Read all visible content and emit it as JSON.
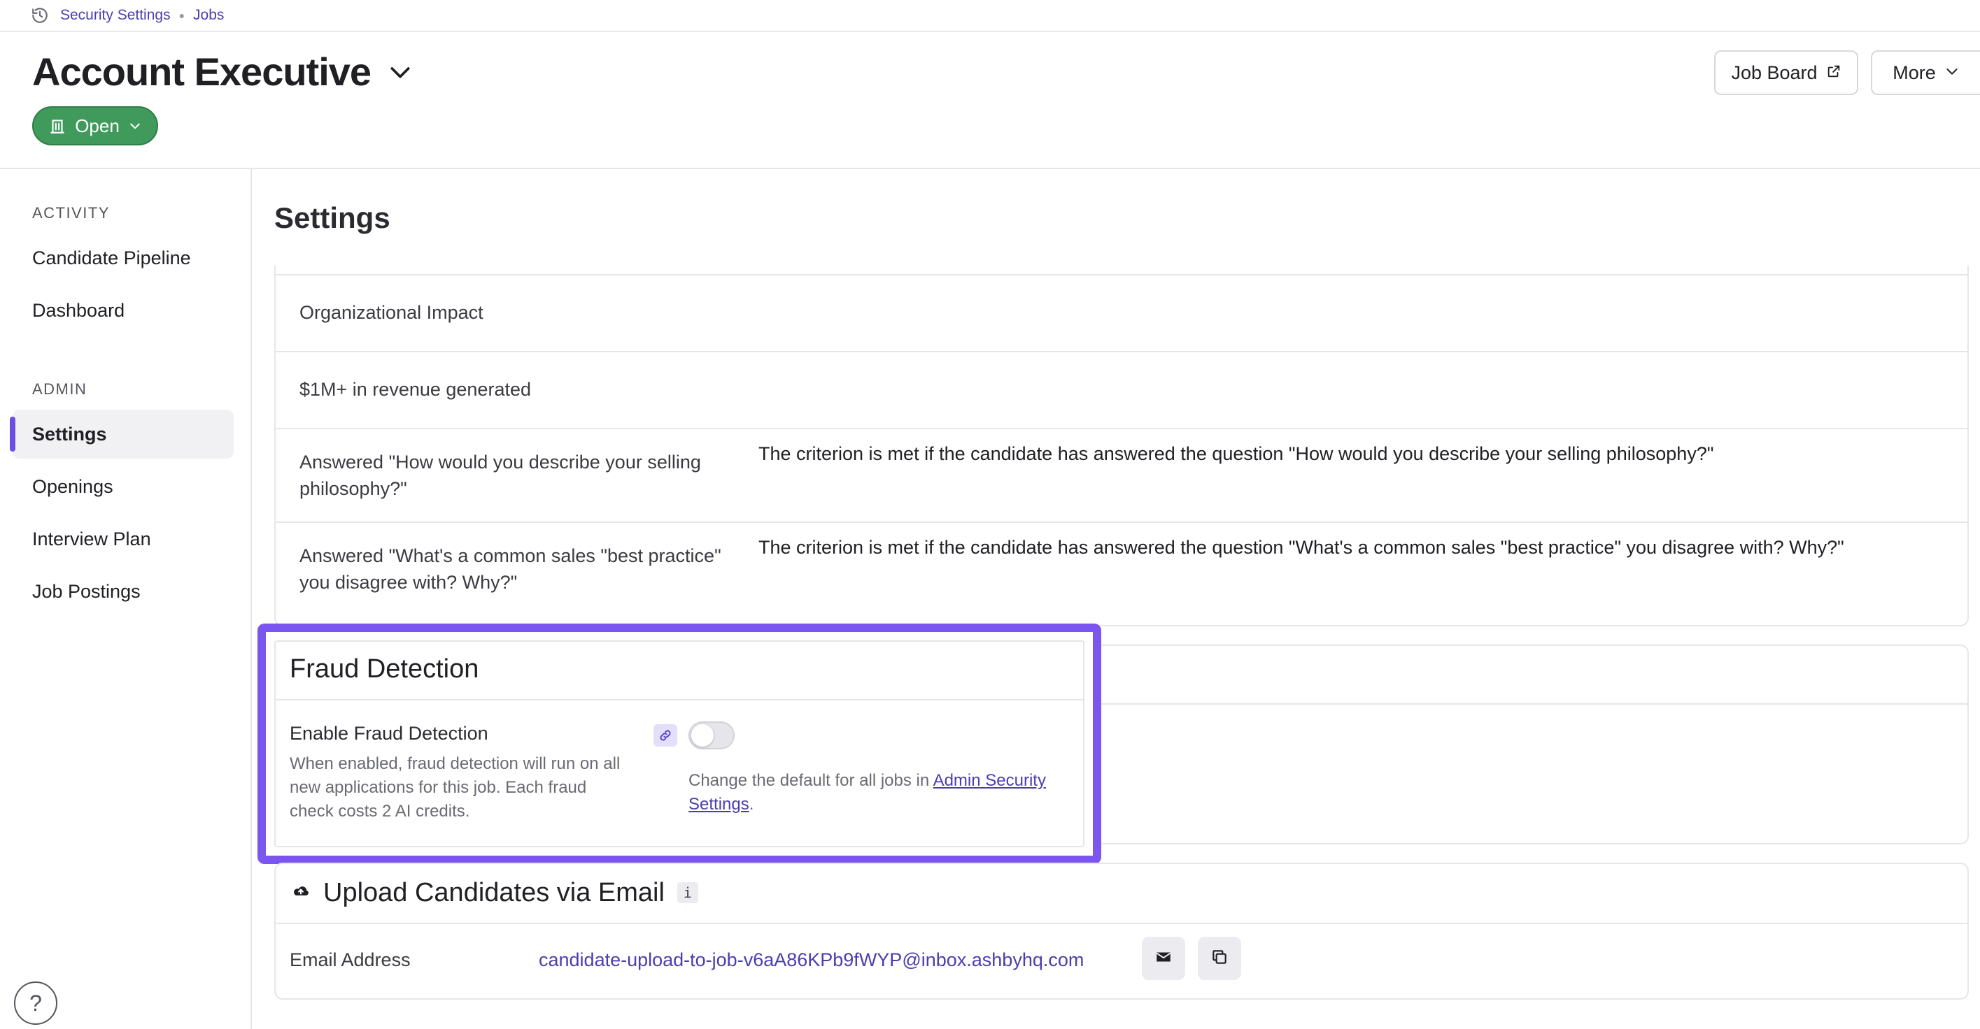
{
  "breadcrumb": {
    "icon": "history-icon",
    "items": [
      "Security Settings",
      "Jobs"
    ]
  },
  "header": {
    "title": "Account Executive",
    "status": "Open",
    "job_board_label": "Job Board",
    "more_label": "More"
  },
  "sidebar": {
    "activity_heading": "ACTIVITY",
    "activity_items": [
      "Candidate Pipeline",
      "Dashboard"
    ],
    "admin_heading": "ADMIN",
    "admin_items": [
      "Settings",
      "Openings",
      "Interview Plan",
      "Job Postings"
    ],
    "active_item": "Settings",
    "help_label": "?"
  },
  "main": {
    "title": "Settings",
    "criteria": [
      {
        "name": "Organizational Impact",
        "description": ""
      },
      {
        "name": "$1M+ in revenue generated",
        "description": ""
      },
      {
        "name": "Answered \"How would you describe your selling philosophy?\"",
        "description": "The criterion is met if the candidate has answered the question \"How would you describe your selling philosophy?\""
      },
      {
        "name": "Answered \"What's a common sales \"best practice\" you disagree with? Why?\"",
        "description": "The criterion is met if the candidate has answered the question \"What's a common sales \"best practice\" you disagree with? Why?\""
      }
    ],
    "fraud": {
      "title": "Fraud Detection",
      "label": "Enable Fraud Detection",
      "help": "When enabled, fraud detection will run on all new applications for this job. Each fraud check costs 2 AI credits.",
      "toggle_on": false,
      "note_prefix": "Change the default for all jobs in ",
      "note_link": "Admin Security Settings",
      "note_suffix": "."
    },
    "upload": {
      "title": "Upload Candidates via Email",
      "info_badge": "i",
      "email_label": "Email Address",
      "email_value": "candidate-upload-to-job-v6aA86KPb9fWYP@inbox.ashbyhq.com"
    }
  },
  "colors": {
    "accent": "#4a3fb0",
    "highlight": "#7b55f0",
    "status_green": "#3f9a5c"
  }
}
